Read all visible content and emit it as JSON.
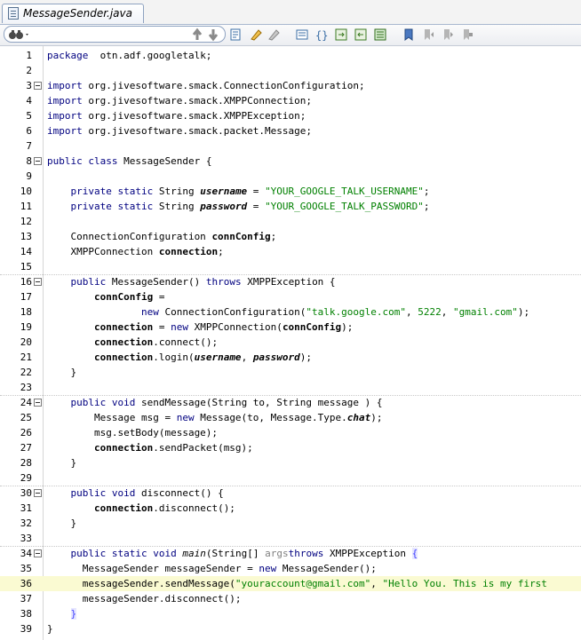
{
  "tab": {
    "label": "MessageSender.java"
  },
  "toolbar": {
    "icons": [
      "binoculars-icon",
      "history-back-icon",
      "history-forward-icon",
      "find-icon",
      "highlight-icon",
      "clear-highlight-icon",
      "toggle-comment-icon",
      "braces-icon",
      "indent-icon",
      "outdent-icon",
      "shift-icon",
      "bookmark-icon",
      "prev-bookmark-icon",
      "next-bookmark-icon",
      "clear-bookmark-icon"
    ]
  },
  "editor": {
    "lines": [
      {
        "n": "1",
        "code": [
          [
            "kw",
            "package"
          ],
          [
            "",
            "  otn.adf.googletalk;"
          ]
        ]
      },
      {
        "n": "2",
        "code": []
      },
      {
        "n": "3",
        "code": [
          [
            "kw",
            "import"
          ],
          [
            "",
            " org.jivesoftware.smack.ConnectionConfiguration;"
          ]
        ]
      },
      {
        "n": "4",
        "code": [
          [
            "kw",
            "import"
          ],
          [
            "",
            " org.jivesoftware.smack.XMPPConnection;"
          ]
        ]
      },
      {
        "n": "5",
        "code": [
          [
            "kw",
            "import"
          ],
          [
            "",
            " org.jivesoftware.smack.XMPPException;"
          ]
        ]
      },
      {
        "n": "6",
        "code": [
          [
            "kw",
            "import"
          ],
          [
            "",
            " org.jivesoftware.smack.packet.Message;"
          ]
        ]
      },
      {
        "n": "7",
        "code": []
      },
      {
        "n": "8",
        "code": [
          [
            "kw",
            "public class"
          ],
          [
            "",
            " MessageSender {"
          ]
        ]
      },
      {
        "n": "9",
        "code": []
      },
      {
        "n": "10",
        "code": [
          [
            "",
            "    "
          ],
          [
            "kw",
            "private static"
          ],
          [
            "",
            " String "
          ],
          [
            "sfld",
            "username"
          ],
          [
            "",
            " = "
          ],
          [
            "str",
            "\"YOUR_GOOGLE_TALK_USERNAME\""
          ],
          [
            "",
            ";"
          ]
        ]
      },
      {
        "n": "11",
        "code": [
          [
            "",
            "    "
          ],
          [
            "kw",
            "private static"
          ],
          [
            "",
            " String "
          ],
          [
            "sfld",
            "password"
          ],
          [
            "",
            " = "
          ],
          [
            "str",
            "\"YOUR_GOOGLE_TALK_PASSWORD\""
          ],
          [
            "",
            ";"
          ]
        ]
      },
      {
        "n": "12",
        "code": []
      },
      {
        "n": "13",
        "code": [
          [
            "",
            "    ConnectionConfiguration "
          ],
          [
            "fld",
            "connConfig"
          ],
          [
            "",
            ";"
          ]
        ]
      },
      {
        "n": "14",
        "code": [
          [
            "",
            "    XMPPConnection "
          ],
          [
            "fld",
            "connection"
          ],
          [
            "",
            ";"
          ]
        ]
      },
      {
        "n": "15",
        "code": []
      },
      {
        "n": "16",
        "code": [
          [
            "",
            "    "
          ],
          [
            "kw",
            "public"
          ],
          [
            "",
            " MessageSender() "
          ],
          [
            "kw",
            "throws"
          ],
          [
            "",
            " XMPPException {"
          ]
        ]
      },
      {
        "n": "17",
        "code": [
          [
            "",
            "        "
          ],
          [
            "fld",
            "connConfig"
          ],
          [
            "",
            " ="
          ]
        ]
      },
      {
        "n": "18",
        "code": [
          [
            "",
            "                "
          ],
          [
            "kw",
            "new"
          ],
          [
            "",
            " ConnectionConfiguration("
          ],
          [
            "str",
            "\"talk.google.com\""
          ],
          [
            "",
            ", "
          ],
          [
            "str",
            "5222"
          ],
          [
            "",
            ", "
          ],
          [
            "str",
            "\"gmail.com\""
          ],
          [
            "",
            ");"
          ]
        ]
      },
      {
        "n": "19",
        "code": [
          [
            "",
            "        "
          ],
          [
            "fld",
            "connection"
          ],
          [
            "",
            " = "
          ],
          [
            "kw",
            "new"
          ],
          [
            "",
            " XMPPConnection("
          ],
          [
            "fld",
            "connConfig"
          ],
          [
            "",
            ");"
          ]
        ]
      },
      {
        "n": "20",
        "code": [
          [
            "",
            "        "
          ],
          [
            "fld",
            "connection"
          ],
          [
            "",
            ".connect();"
          ]
        ]
      },
      {
        "n": "21",
        "code": [
          [
            "",
            "        "
          ],
          [
            "fld",
            "connection"
          ],
          [
            "",
            ".login("
          ],
          [
            "sfld",
            "username"
          ],
          [
            "",
            ", "
          ],
          [
            "sfld",
            "password"
          ],
          [
            "",
            ");"
          ]
        ]
      },
      {
        "n": "22",
        "code": [
          [
            "",
            "    }"
          ]
        ]
      },
      {
        "n": "23",
        "code": []
      },
      {
        "n": "24",
        "code": [
          [
            "",
            "    "
          ],
          [
            "kw",
            "public void"
          ],
          [
            "",
            " sendMessage(String to, String message ) {"
          ]
        ]
      },
      {
        "n": "25",
        "code": [
          [
            "",
            "        Message msg = "
          ],
          [
            "kw",
            "new"
          ],
          [
            "",
            " Message(to, Message.Type."
          ],
          [
            "sfld",
            "chat"
          ],
          [
            "",
            ");"
          ]
        ]
      },
      {
        "n": "26",
        "code": [
          [
            "",
            "        msg.setBody(message);"
          ]
        ]
      },
      {
        "n": "27",
        "code": [
          [
            "",
            "        "
          ],
          [
            "fld",
            "connection"
          ],
          [
            "",
            ".sendPacket(msg);"
          ]
        ]
      },
      {
        "n": "28",
        "code": [
          [
            "",
            "    }"
          ]
        ]
      },
      {
        "n": "29",
        "code": []
      },
      {
        "n": "30",
        "code": [
          [
            "",
            "    "
          ],
          [
            "kw",
            "public void"
          ],
          [
            "",
            " disconnect() {"
          ]
        ]
      },
      {
        "n": "31",
        "code": [
          [
            "",
            "        "
          ],
          [
            "fld",
            "connection"
          ],
          [
            "",
            ".disconnect();"
          ]
        ]
      },
      {
        "n": "32",
        "code": [
          [
            "",
            "    }"
          ]
        ]
      },
      {
        "n": "33",
        "code": []
      },
      {
        "n": "34",
        "code": [
          [
            "",
            "    "
          ],
          [
            "kw",
            "public static void"
          ],
          [
            "",
            " "
          ],
          [
            "smeth",
            "main"
          ],
          [
            "",
            "(String[] "
          ],
          [
            "param",
            "args"
          ],
          [
            ") "
          ],
          [
            "kw",
            "throws"
          ],
          [
            "",
            " XMPPException "
          ],
          [
            "brace-m",
            "{"
          ]
        ]
      },
      {
        "n": "35",
        "code": [
          [
            "",
            "      MessageSender messageSender = "
          ],
          [
            "kw",
            "new"
          ],
          [
            "",
            " MessageSender();"
          ]
        ]
      },
      {
        "n": "36",
        "code": [
          [
            "",
            "      messageSender.sendMessage("
          ],
          [
            "str",
            "\"youraccount@gmail.com\""
          ],
          [
            "",
            ", "
          ],
          [
            "str",
            "\"Hello You. This is my first"
          ]
        ]
      },
      {
        "n": "37",
        "code": [
          [
            "",
            "      messageSender.disconnect();"
          ]
        ]
      },
      {
        "n": "38",
        "code": [
          [
            "",
            "    "
          ],
          [
            "brace-m",
            "}"
          ]
        ]
      },
      {
        "n": "39",
        "code": [
          [
            "",
            "}"
          ]
        ]
      }
    ]
  }
}
